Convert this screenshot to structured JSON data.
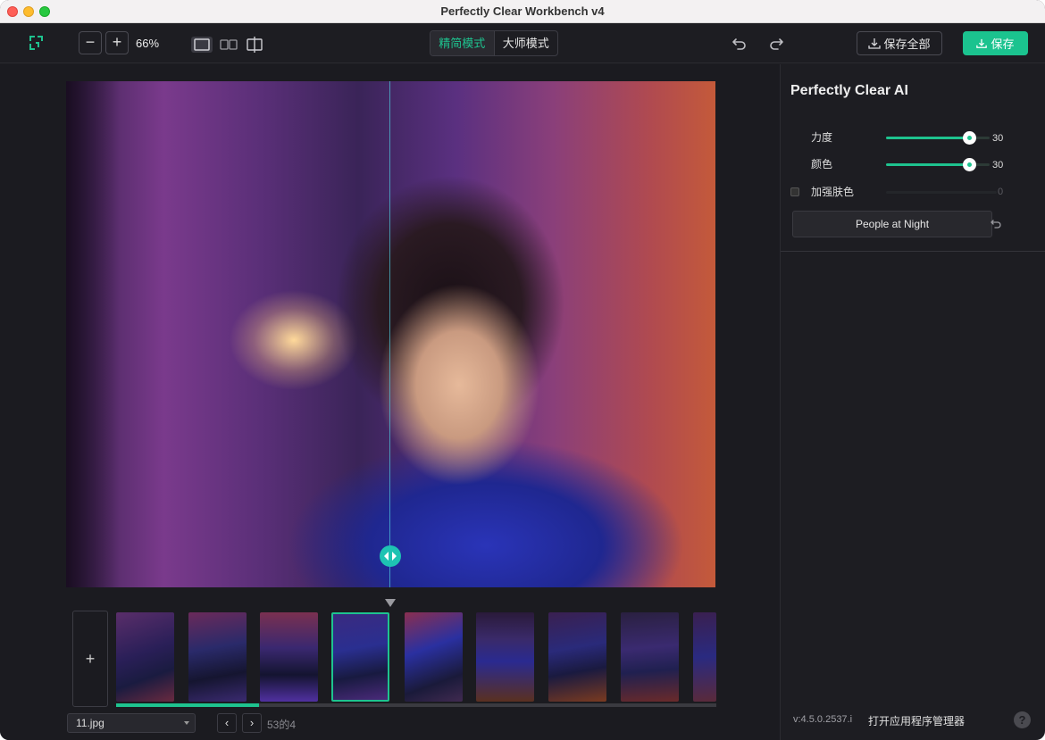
{
  "window": {
    "title": "Perfectly Clear Workbench v4"
  },
  "toolbar": {
    "zoom_out": "−",
    "zoom_in": "+",
    "zoom_level": "66%",
    "modes": [
      {
        "label": "精简模式",
        "active": true
      },
      {
        "label": "大师模式",
        "active": false
      }
    ],
    "save_all_label": "保存全部",
    "save_label": "保存"
  },
  "filmstrip": {
    "add_label": "+",
    "thumbnail_count": 9,
    "selected_index": 3
  },
  "footer": {
    "file_name": "11.jpg",
    "prev": "‹",
    "next": "›",
    "page_text": "53的4",
    "version": "v:4.5.0.2537.i",
    "manager_label": "打开应用程序管理器",
    "help_label": "?"
  },
  "panel": {
    "title": "Perfectly Clear AI",
    "sliders": [
      {
        "label": "力度",
        "value": "30",
        "fraction": 0.8
      },
      {
        "label": "颜色",
        "value": "30",
        "fraction": 0.8
      }
    ],
    "skin": {
      "label": "加强肤色",
      "value": "0",
      "checked": false
    },
    "preset_label": "People at Night"
  },
  "colors": {
    "accent": "#1ec38f",
    "background": "#1d1d22"
  }
}
